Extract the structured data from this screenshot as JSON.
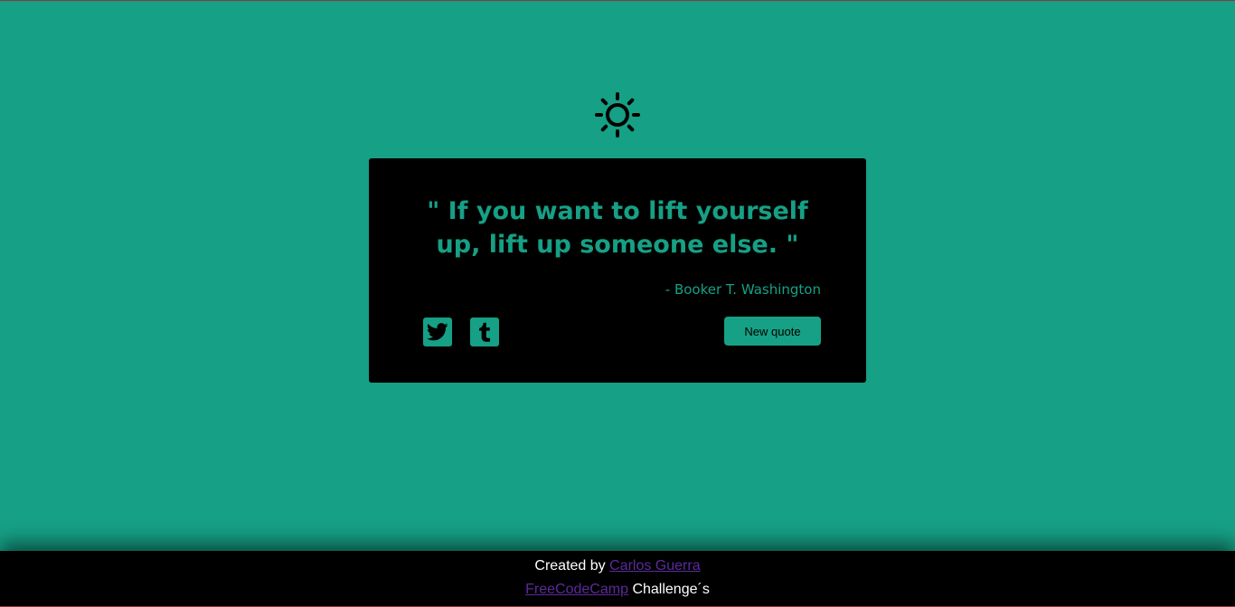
{
  "theme_toggle": {
    "icon": "sun-icon"
  },
  "quote": {
    "text": "\" If you want to lift yourself up, lift up someone else. \"",
    "author": "- Booker T. Washington"
  },
  "share": {
    "twitter_icon": "twitter-icon",
    "tumblr_icon": "tumblr-icon"
  },
  "buttons": {
    "new_quote_label": "New quote"
  },
  "footer": {
    "created_by": "Created by",
    "author_link": "Carlos Guerra",
    "fcc_link": "FreeCodeCamp",
    "challenges": "Challenge´s"
  },
  "colors": {
    "background": "#16a085",
    "card": "#000000",
    "accent": "#16a085",
    "link": "#5b2a9b"
  }
}
